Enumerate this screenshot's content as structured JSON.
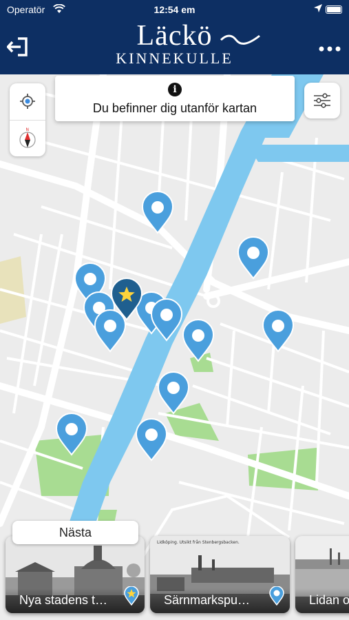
{
  "status_bar": {
    "carrier": "Operatör",
    "time": "12:54 em"
  },
  "header": {
    "logo_line1": "Läckö",
    "logo_line2": "KINNEKULLE",
    "logout_icon": "logout-icon",
    "more_icon": "more-icon"
  },
  "map": {
    "info_message": "Du befinner dig utanför kartan",
    "info_icon": "info-icon",
    "controls": [
      "locate-icon",
      "compass-icon"
    ],
    "filter_icon": "filter-icon",
    "colors": {
      "pin": "#4a9fdd",
      "pin_selected": "#1f5f8f",
      "water": "#7ec8ef",
      "park": "#a8dc92",
      "road": "#ffffff",
      "land": "#ececec"
    }
  },
  "bottom": {
    "next_label": "Nästa",
    "cards": [
      {
        "title": "Nya stadens t…",
        "badge": "star-pin-icon"
      },
      {
        "title": "Särnmarkspu…",
        "badge": "pin-icon"
      },
      {
        "title": "Lidan o",
        "badge": ""
      }
    ],
    "photo_captions": [
      "Lidköping. Utsikt från Stenbergsbacken."
    ]
  }
}
